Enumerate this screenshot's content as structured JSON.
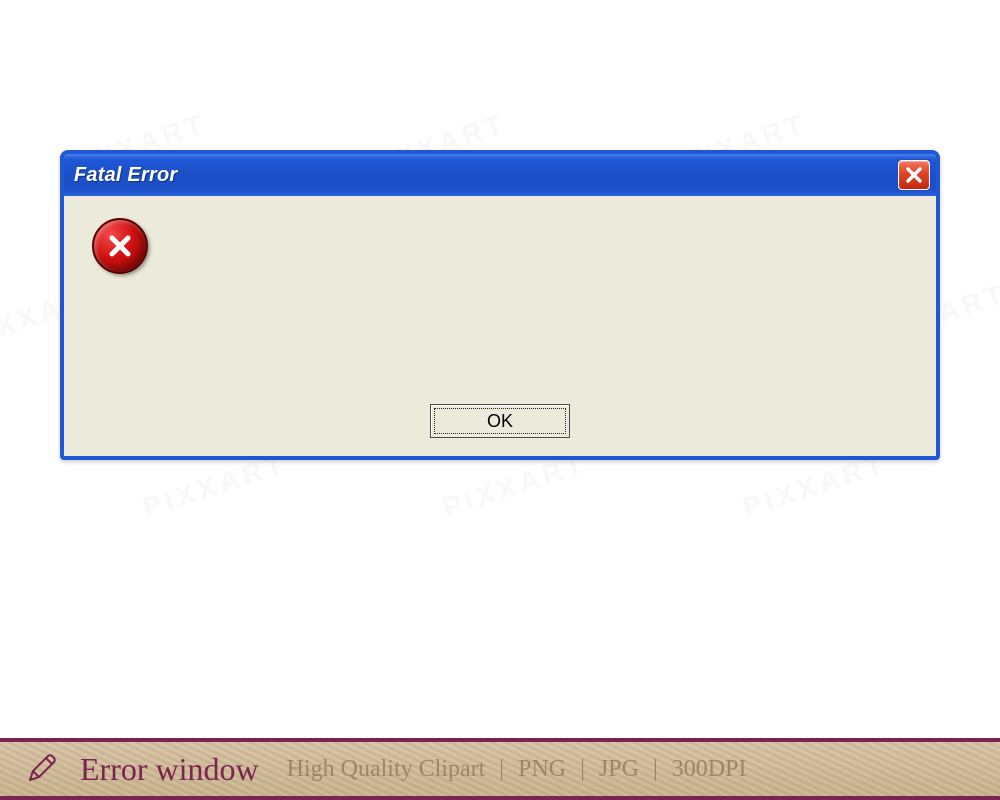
{
  "dialog": {
    "title": "Fatal Error",
    "message": "",
    "ok_label": "OK"
  },
  "banner": {
    "title": "Error window",
    "subtitle": "High Quality Clipart",
    "format1": "PNG",
    "format2": "JPG",
    "dpi": "300DPI"
  },
  "watermark": "PIXXART"
}
